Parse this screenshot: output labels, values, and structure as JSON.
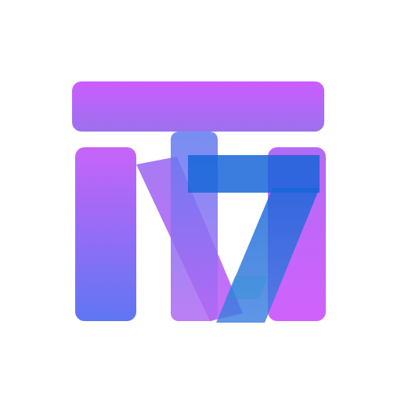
{
  "logo": {
    "lettering": "NT7",
    "colors": {
      "magenta": "#cc63ff",
      "violet": "#a66af0",
      "blue": "#5a73f2",
      "seven_blue": "#1d63d6",
      "seven_teal": "#2d8fd9",
      "background": "#ffffff"
    }
  }
}
